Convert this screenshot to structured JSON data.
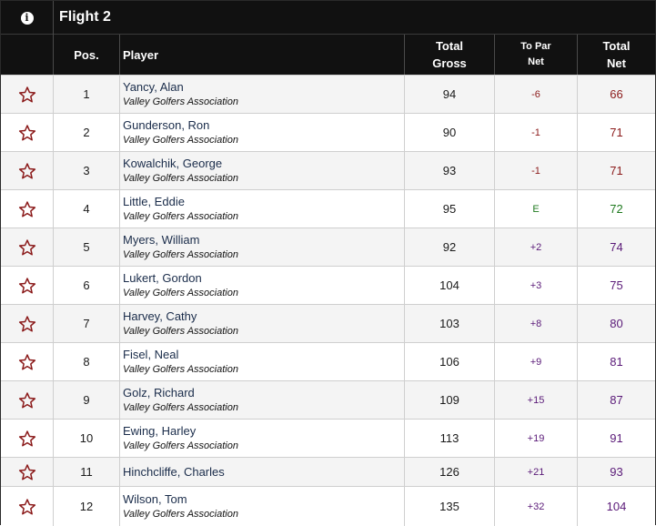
{
  "flight_title": "Flight 2",
  "headers": {
    "pos": "Pos.",
    "player": "Player",
    "gross_line1": "Total",
    "gross_line2": "Gross",
    "topar_line1": "To Par",
    "topar_line2": "Net",
    "net_line1": "Total",
    "net_line2": "Net"
  },
  "colors": {
    "under_par": "#8b1a1a",
    "even_par": "#1f7a1f",
    "over_par": "#5a1a78",
    "star": "#8b1a1a"
  },
  "players": [
    {
      "pos": "1",
      "name": "Yancy, Alan",
      "club": "Valley Golfers Association",
      "gross": "94",
      "to_par": "-6",
      "net": "66",
      "status": "under"
    },
    {
      "pos": "2",
      "name": "Gunderson, Ron",
      "club": "Valley Golfers Association",
      "gross": "90",
      "to_par": "-1",
      "net": "71",
      "status": "under"
    },
    {
      "pos": "3",
      "name": "Kowalchik, George",
      "club": "Valley Golfers Association",
      "gross": "93",
      "to_par": "-1",
      "net": "71",
      "status": "under"
    },
    {
      "pos": "4",
      "name": "Little, Eddie",
      "club": "Valley Golfers Association",
      "gross": "95",
      "to_par": "E",
      "net": "72",
      "status": "even"
    },
    {
      "pos": "5",
      "name": "Myers, William",
      "club": "Valley Golfers Association",
      "gross": "92",
      "to_par": "+2",
      "net": "74",
      "status": "over"
    },
    {
      "pos": "6",
      "name": "Lukert, Gordon",
      "club": "Valley Golfers Association",
      "gross": "104",
      "to_par": "+3",
      "net": "75",
      "status": "over"
    },
    {
      "pos": "7",
      "name": "Harvey, Cathy",
      "club": "Valley Golfers Association",
      "gross": "103",
      "to_par": "+8",
      "net": "80",
      "status": "over"
    },
    {
      "pos": "8",
      "name": "Fisel, Neal",
      "club": "Valley Golfers Association",
      "gross": "106",
      "to_par": "+9",
      "net": "81",
      "status": "over"
    },
    {
      "pos": "9",
      "name": "Golz, Richard",
      "club": "Valley Golfers Association",
      "gross": "109",
      "to_par": "+15",
      "net": "87",
      "status": "over"
    },
    {
      "pos": "10",
      "name": "Ewing, Harley",
      "club": "Valley Golfers Association",
      "gross": "113",
      "to_par": "+19",
      "net": "91",
      "status": "over"
    },
    {
      "pos": "11",
      "name": "Hinchcliffe, Charles",
      "club": "",
      "gross": "126",
      "to_par": "+21",
      "net": "93",
      "status": "over"
    },
    {
      "pos": "12",
      "name": "Wilson, Tom",
      "club": "Valley Golfers Association",
      "gross": "135",
      "to_par": "+32",
      "net": "104",
      "status": "over"
    }
  ]
}
